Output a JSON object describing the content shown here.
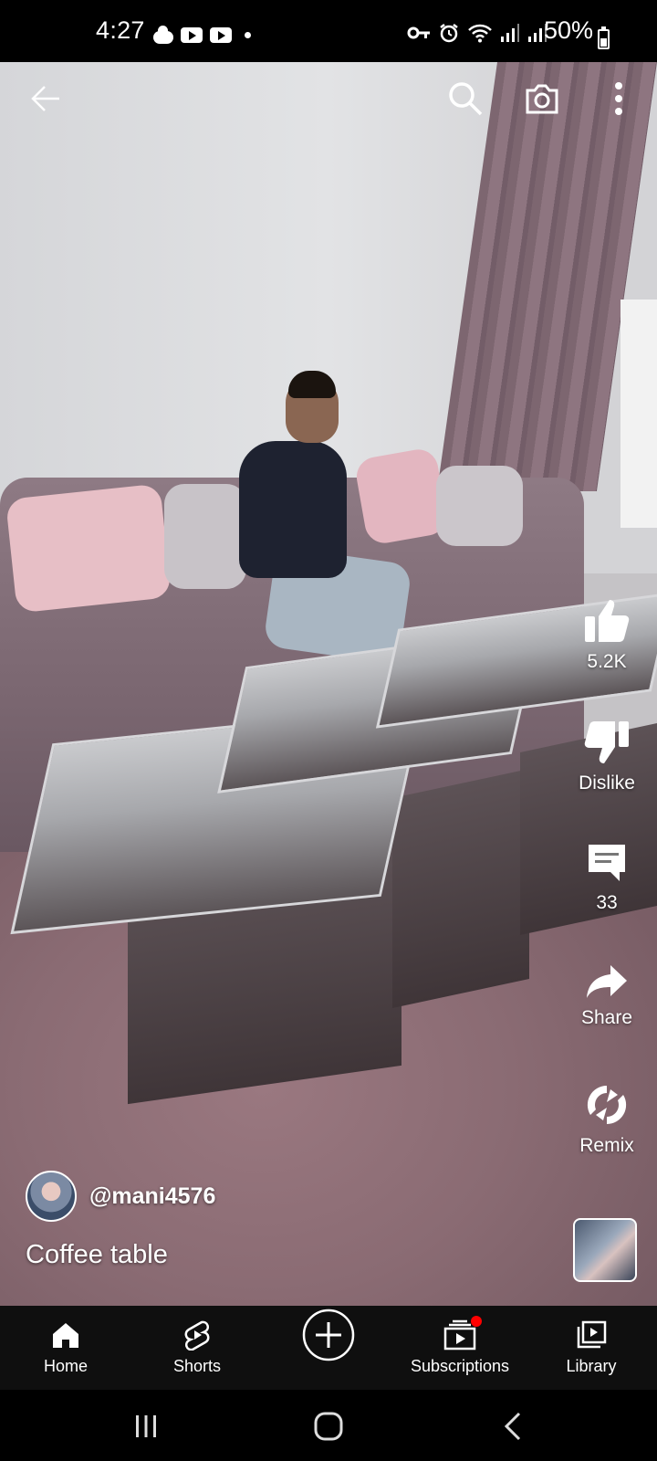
{
  "status_bar": {
    "time": "4:27",
    "battery": "50%"
  },
  "top_bar": {
    "back_icon": "arrow-left-icon",
    "search_icon": "search-icon",
    "camera_icon": "camera-icon",
    "more_icon": "more-vert-icon"
  },
  "actions": {
    "like_count": "5.2K",
    "dislike_label": "Dislike",
    "comment_count": "33",
    "share_label": "Share",
    "remix_label": "Remix"
  },
  "video": {
    "channel": "@mani4576",
    "title": "Coffee table"
  },
  "bottom_nav": {
    "items": [
      {
        "label": "Home",
        "icon": "home-icon"
      },
      {
        "label": "Shorts",
        "icon": "shorts-icon"
      },
      {
        "label": "",
        "icon": "create-icon"
      },
      {
        "label": "Subscriptions",
        "icon": "subscriptions-icon"
      },
      {
        "label": "Library",
        "icon": "library-icon"
      }
    ]
  },
  "colors": {
    "notification_dot": "#ff0000",
    "nav_background": "#0f0f0f"
  }
}
